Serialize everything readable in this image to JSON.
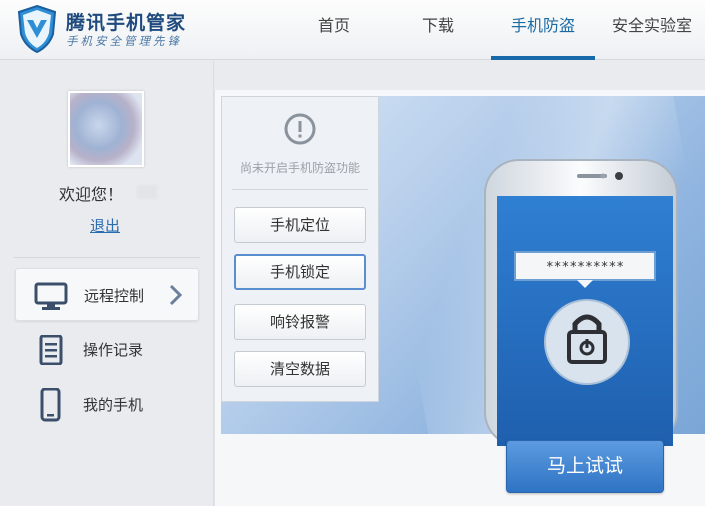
{
  "header": {
    "brand_title": "腾讯手机管家",
    "brand_slogan": "手机安全管理先锋",
    "nav": [
      {
        "label": "首页"
      },
      {
        "label": "下载"
      },
      {
        "label": "手机防盗",
        "active": true
      },
      {
        "label": "安全实验室"
      }
    ]
  },
  "sidebar": {
    "welcome": "欢迎您！",
    "logout": "退出",
    "menu": [
      {
        "label": "远程控制",
        "icon": "monitor-icon",
        "active": true
      },
      {
        "label": "操作记录",
        "icon": "document-icon"
      },
      {
        "label": "我的手机",
        "icon": "phone-icon"
      }
    ]
  },
  "main": {
    "notice": "尚未开启手机防盗功能",
    "actions": [
      {
        "label": "手机定位"
      },
      {
        "label": "手机锁定",
        "selected": true
      },
      {
        "label": "响铃报警"
      },
      {
        "label": "清空数据"
      }
    ],
    "password_mask": "**********",
    "try_button": "马上试试"
  },
  "colors": {
    "brand_blue": "#1f4a7d",
    "nav_active": "#1769aa",
    "link": "#2a6cb0",
    "try_button": "#3d84d2"
  }
}
